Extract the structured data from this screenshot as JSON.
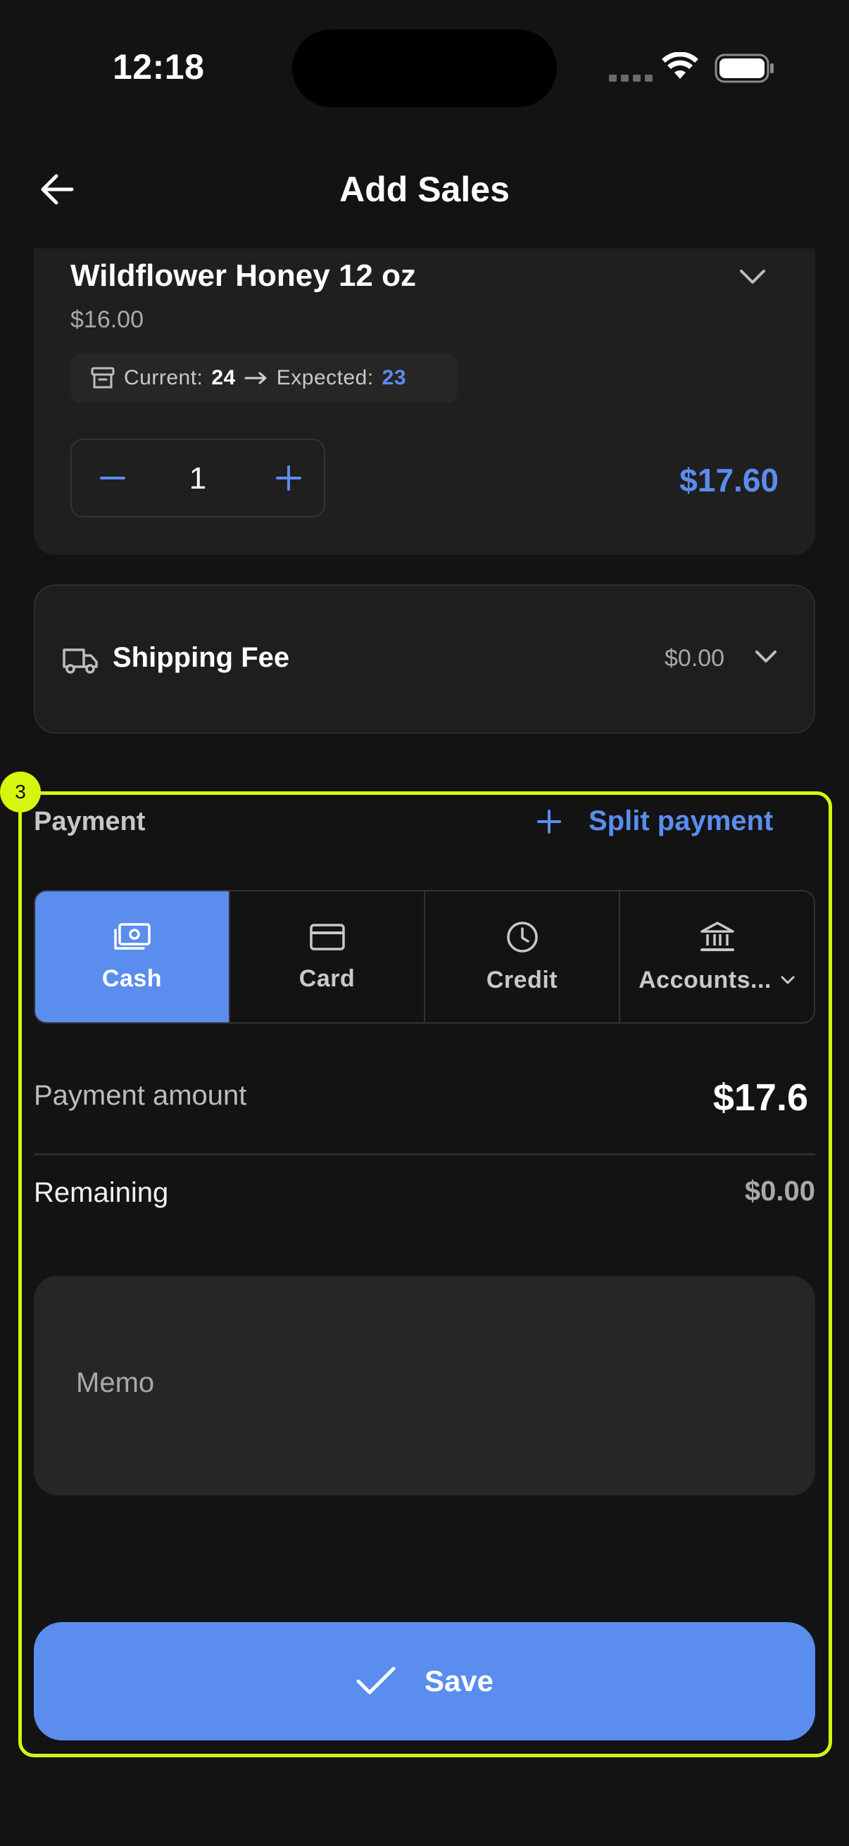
{
  "status_bar": {
    "time": "12:18"
  },
  "header": {
    "title": "Add Sales"
  },
  "product": {
    "name": "Wildflower Honey 12 oz",
    "price": "$16.00",
    "current_label": "Current:",
    "current_value": "24",
    "expected_label": "Expected:",
    "expected_value": "23",
    "quantity": "1",
    "total": "$17.60"
  },
  "shipping": {
    "label": "Shipping Fee",
    "value": "$0.00"
  },
  "highlight": {
    "badge": "3"
  },
  "payment": {
    "label": "Payment",
    "split_label": "Split payment",
    "methods": [
      {
        "label": "Cash",
        "icon": "cash-icon",
        "active": true
      },
      {
        "label": "Card",
        "icon": "card-icon",
        "active": false
      },
      {
        "label": "Credit",
        "icon": "clock-icon",
        "active": false
      },
      {
        "label": "Accounts...",
        "icon": "bank-icon",
        "active": false
      }
    ],
    "amount_label": "Payment amount",
    "amount_value": "$17.6",
    "remaining_label": "Remaining",
    "remaining_value": "$0.00",
    "memo_placeholder": "Memo"
  },
  "actions": {
    "save_label": "Save"
  },
  "colors": {
    "accent": "#5b8def",
    "highlight": "#d7f60f",
    "background": "#131313"
  }
}
